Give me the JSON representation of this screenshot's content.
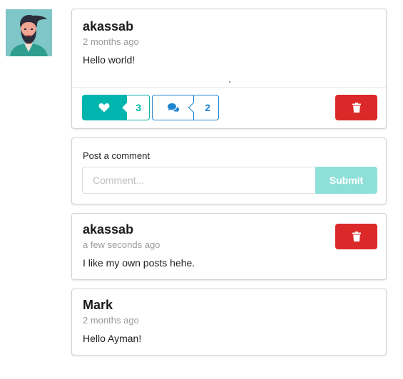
{
  "post": {
    "author": "akassab",
    "time": "2 months ago",
    "text": "Hello world!",
    "likes": "3",
    "comments": "2"
  },
  "comment_form": {
    "label": "Post a comment",
    "placeholder": "Comment...",
    "submit_label": "Submit"
  },
  "comments": [
    {
      "author": "akassab",
      "time": "a few seconds ago",
      "text": "I like my own posts hehe."
    },
    {
      "author": "Mark",
      "time": "2 months ago",
      "text": "Hello Ayman!"
    }
  ],
  "icons": {
    "like": "heart-icon",
    "comment": "comments-icon",
    "delete": "trash-icon"
  },
  "colors": {
    "teal": "#00b5ad",
    "blue": "#2185d0",
    "red": "#db2828",
    "submit_disabled": "#8fdfd9"
  }
}
